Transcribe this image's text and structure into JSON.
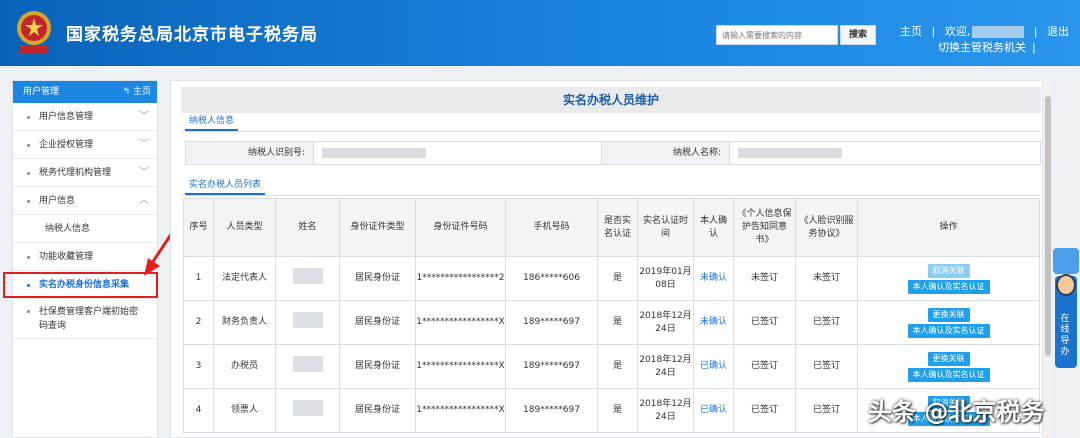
{
  "header": {
    "title": "国家税务总局北京市电子税务局",
    "search_placeholder": "请输入需要搜索的内容",
    "search_label": "搜索",
    "home": "主页",
    "welcome": "欢迎,",
    "logout": "退出",
    "switch": "切换主管税务机关",
    "divider": "|",
    "brand_color": "#1a86e0"
  },
  "sidebar": {
    "header": "用户管理",
    "home": "主页",
    "items": [
      {
        "label": "用户信息管理"
      },
      {
        "label": "企业授权管理"
      },
      {
        "label": "税务代理机构管理"
      },
      {
        "label": "用户信息"
      },
      {
        "label": "纳税人信息"
      },
      {
        "label": "功能收藏管理"
      },
      {
        "label": "实名办税身份信息采集"
      },
      {
        "label": "社保费管理客户端初始密码查询"
      }
    ]
  },
  "main": {
    "title": "实名办税人员维护",
    "tab_info": "纳税人信息",
    "label_taxid": "纳税人识别号:",
    "label_name": "纳税人名称:",
    "tab_list": "实名办税人员列表"
  },
  "table": {
    "headers": [
      "序号",
      "人员类型",
      "姓名",
      "身份证件类型",
      "身份证件号码",
      "手机号码",
      "是否实名认证",
      "实名认证时间",
      "本人确认",
      "《个人信息保护告知同意书》",
      "《人脸识别服务协议》",
      "操作"
    ],
    "rows": [
      {
        "no": "1",
        "type": "法定代表人",
        "idtype": "居民身份证",
        "idno": "1*****************2",
        "phone": "186*****606",
        "verified": "是",
        "time": "2019年01月08日",
        "confirm": "未确认",
        "privacy": "未签订",
        "face": "未签订",
        "btn1": "取消关联",
        "btn2": "本人确认及实名认证"
      },
      {
        "no": "2",
        "type": "财务负责人",
        "idtype": "居民身份证",
        "idno": "1*****************X",
        "phone": "189*****697",
        "verified": "是",
        "time": "2018年12月24日",
        "confirm": "未确认",
        "privacy": "已签订",
        "face": "已签订",
        "btn1": "更换关联",
        "btn2": "本人确认及实名认证"
      },
      {
        "no": "3",
        "type": "办税员",
        "idtype": "居民身份证",
        "idno": "1*****************X",
        "phone": "189*****697",
        "verified": "是",
        "time": "2018年12月24日",
        "confirm": "已确认",
        "privacy": "已签订",
        "face": "已签订",
        "btn1": "更换关联",
        "btn2": "本人确认及实名认证"
      },
      {
        "no": "4",
        "type": "领票人",
        "idtype": "居民身份证",
        "idno": "1*****************X",
        "phone": "189*****697",
        "verified": "是",
        "time": "2018年12月24日",
        "confirm": "已确认",
        "privacy": "已签订",
        "face": "已签订",
        "btn1": "取消关联",
        "btn2": "本人确认及实名认证"
      }
    ]
  },
  "helper": {
    "text": "在线导办"
  },
  "watermark": "头条 @北京税务"
}
